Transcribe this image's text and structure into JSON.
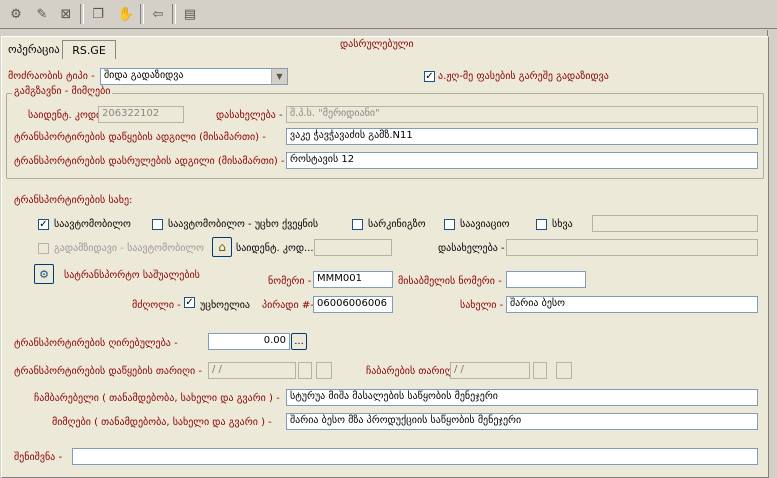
{
  "toolbar": {
    "icons": [
      "new-icon",
      "open-icon",
      "close-icon",
      "copy-icon",
      "stamp-icon",
      "back-arrow-icon",
      "form-icon"
    ]
  },
  "header": {
    "operation_label": "ოპერაცია",
    "tab_label": "RS.GE",
    "status": "დასრულებული"
  },
  "movement": {
    "type_label": "მოძრაობის ტიპი -",
    "type_value": "შიდა გადაზიდვა",
    "outside_zone_label": "ა.ჟღ-მე ფასების გარეშე გადაზიდვა",
    "outside_zone_checked": "✓"
  },
  "sender": {
    "group_title": "გამგზავნი - მიმღები",
    "code_label": "საიდენტ. კოდი -",
    "code_value": "206322102",
    "name_label": "დასახელება -",
    "name_value": "შ.პ.ს. \"მერიდიანი\"",
    "start_label": "ტრანსპორტირების დაწყების ადგილი (მისამართი) -",
    "start_value": "ვაკე ჭავჭავაძის გამზ.N11",
    "end_label": "ტრანსპორტირების დასრულების ადგილი (მისამართი) -",
    "end_value": "როსტავის 12"
  },
  "transport": {
    "section_title": "ტრანსპორტირების სახე:",
    "types": [
      {
        "label": "საავტომობილო",
        "checked": "✓"
      },
      {
        "label": "საავტომობილო - უცხო ქვეყნის",
        "checked": ""
      },
      {
        "label": "სარკინიგზო",
        "checked": ""
      },
      {
        "label": "საავიაციო",
        "checked": ""
      },
      {
        "label": "სხვა",
        "checked": ""
      }
    ],
    "trailer_label": "გადამზიდავი - საავტომობილო",
    "carrier_code_label": "საიდენტ. კოდ...",
    "carrier_name_label": "დასახელება -",
    "vehicle_label": "სატრანსპორტო საშუალების",
    "number_label": "ნომერი -",
    "number_value": "MMM001",
    "trailer_number_label": "მისაბმელის ნომერი -",
    "trailer_number_value": "",
    "driver_label": "მძღოლი -",
    "foreigner_label": "უცხოელია",
    "foreigner_checked": "✓",
    "personal_label": "პირადი #-",
    "personal_value": "06006006006",
    "driver_name_label": "სახელი -",
    "driver_name_value": "შარია ბესო"
  },
  "cost": {
    "label": "ტრანსპორტირების ღირებულება -",
    "value": "0.00",
    "btn": "..."
  },
  "dates": {
    "start_label": "ტრანსპორტირების დაწყების თარიღი -",
    "start_value": "/      /",
    "delivery_label": "ჩაბარების თარიღი -",
    "delivery_value": "/      /"
  },
  "people": {
    "handover_label": "ჩამბარებელი ( თანამდებობა, სახელი და გვარი ) -",
    "handover_value": "სტურუა მიშა მასალების საწყობის მენეჯერი",
    "receiver_label": "მიმღები ( თანამდებობა, სახელი და გვარი ) -",
    "receiver_value": "შარია ბესო მზა პროდუქციის საწყობის მენეჯერი"
  },
  "notes": {
    "label": "შენიშვნა -",
    "value": ""
  }
}
